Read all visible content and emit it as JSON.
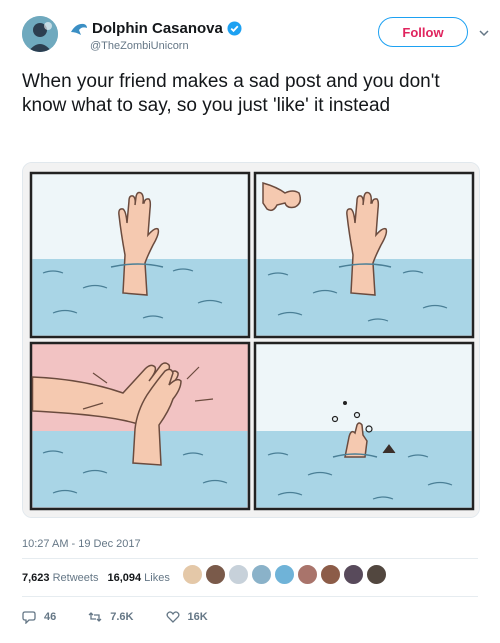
{
  "author": {
    "name": "Dolphin Casanova",
    "handle": "@TheZombiUnicorn"
  },
  "follow_label": "Follow",
  "tweet_text": "When your friend makes a sad post and you don't know what to say, so you just 'like' it instead",
  "timestamp": "10:27 AM - 19 Dec 2017",
  "stats": {
    "retweets_count": "7,623",
    "retweets_label": "Retweets",
    "likes_count": "16,094",
    "likes_label": "Likes"
  },
  "liker_avatar_colors": [
    "#e4c8a8",
    "#7a5a4a",
    "#c7d1da",
    "#8ab2c9",
    "#6fb3d8",
    "#a9746b",
    "#8c5c48",
    "#584a5b",
    "#52473f"
  ],
  "actions": {
    "reply_count": "46",
    "retweet_count": "7.6K",
    "like_count": "16K"
  },
  "colors": {
    "accent": "#1da1f2",
    "follow_text": "#e0245e",
    "water": "#a9d5e6",
    "sky": "#f3f8fa",
    "pink_bg": "#f2c3c3",
    "skin": "#f5c9b0"
  },
  "icons": [
    "brand-icon",
    "verified-icon",
    "caret-icon",
    "reply-icon",
    "retweet-icon",
    "like-icon"
  ]
}
